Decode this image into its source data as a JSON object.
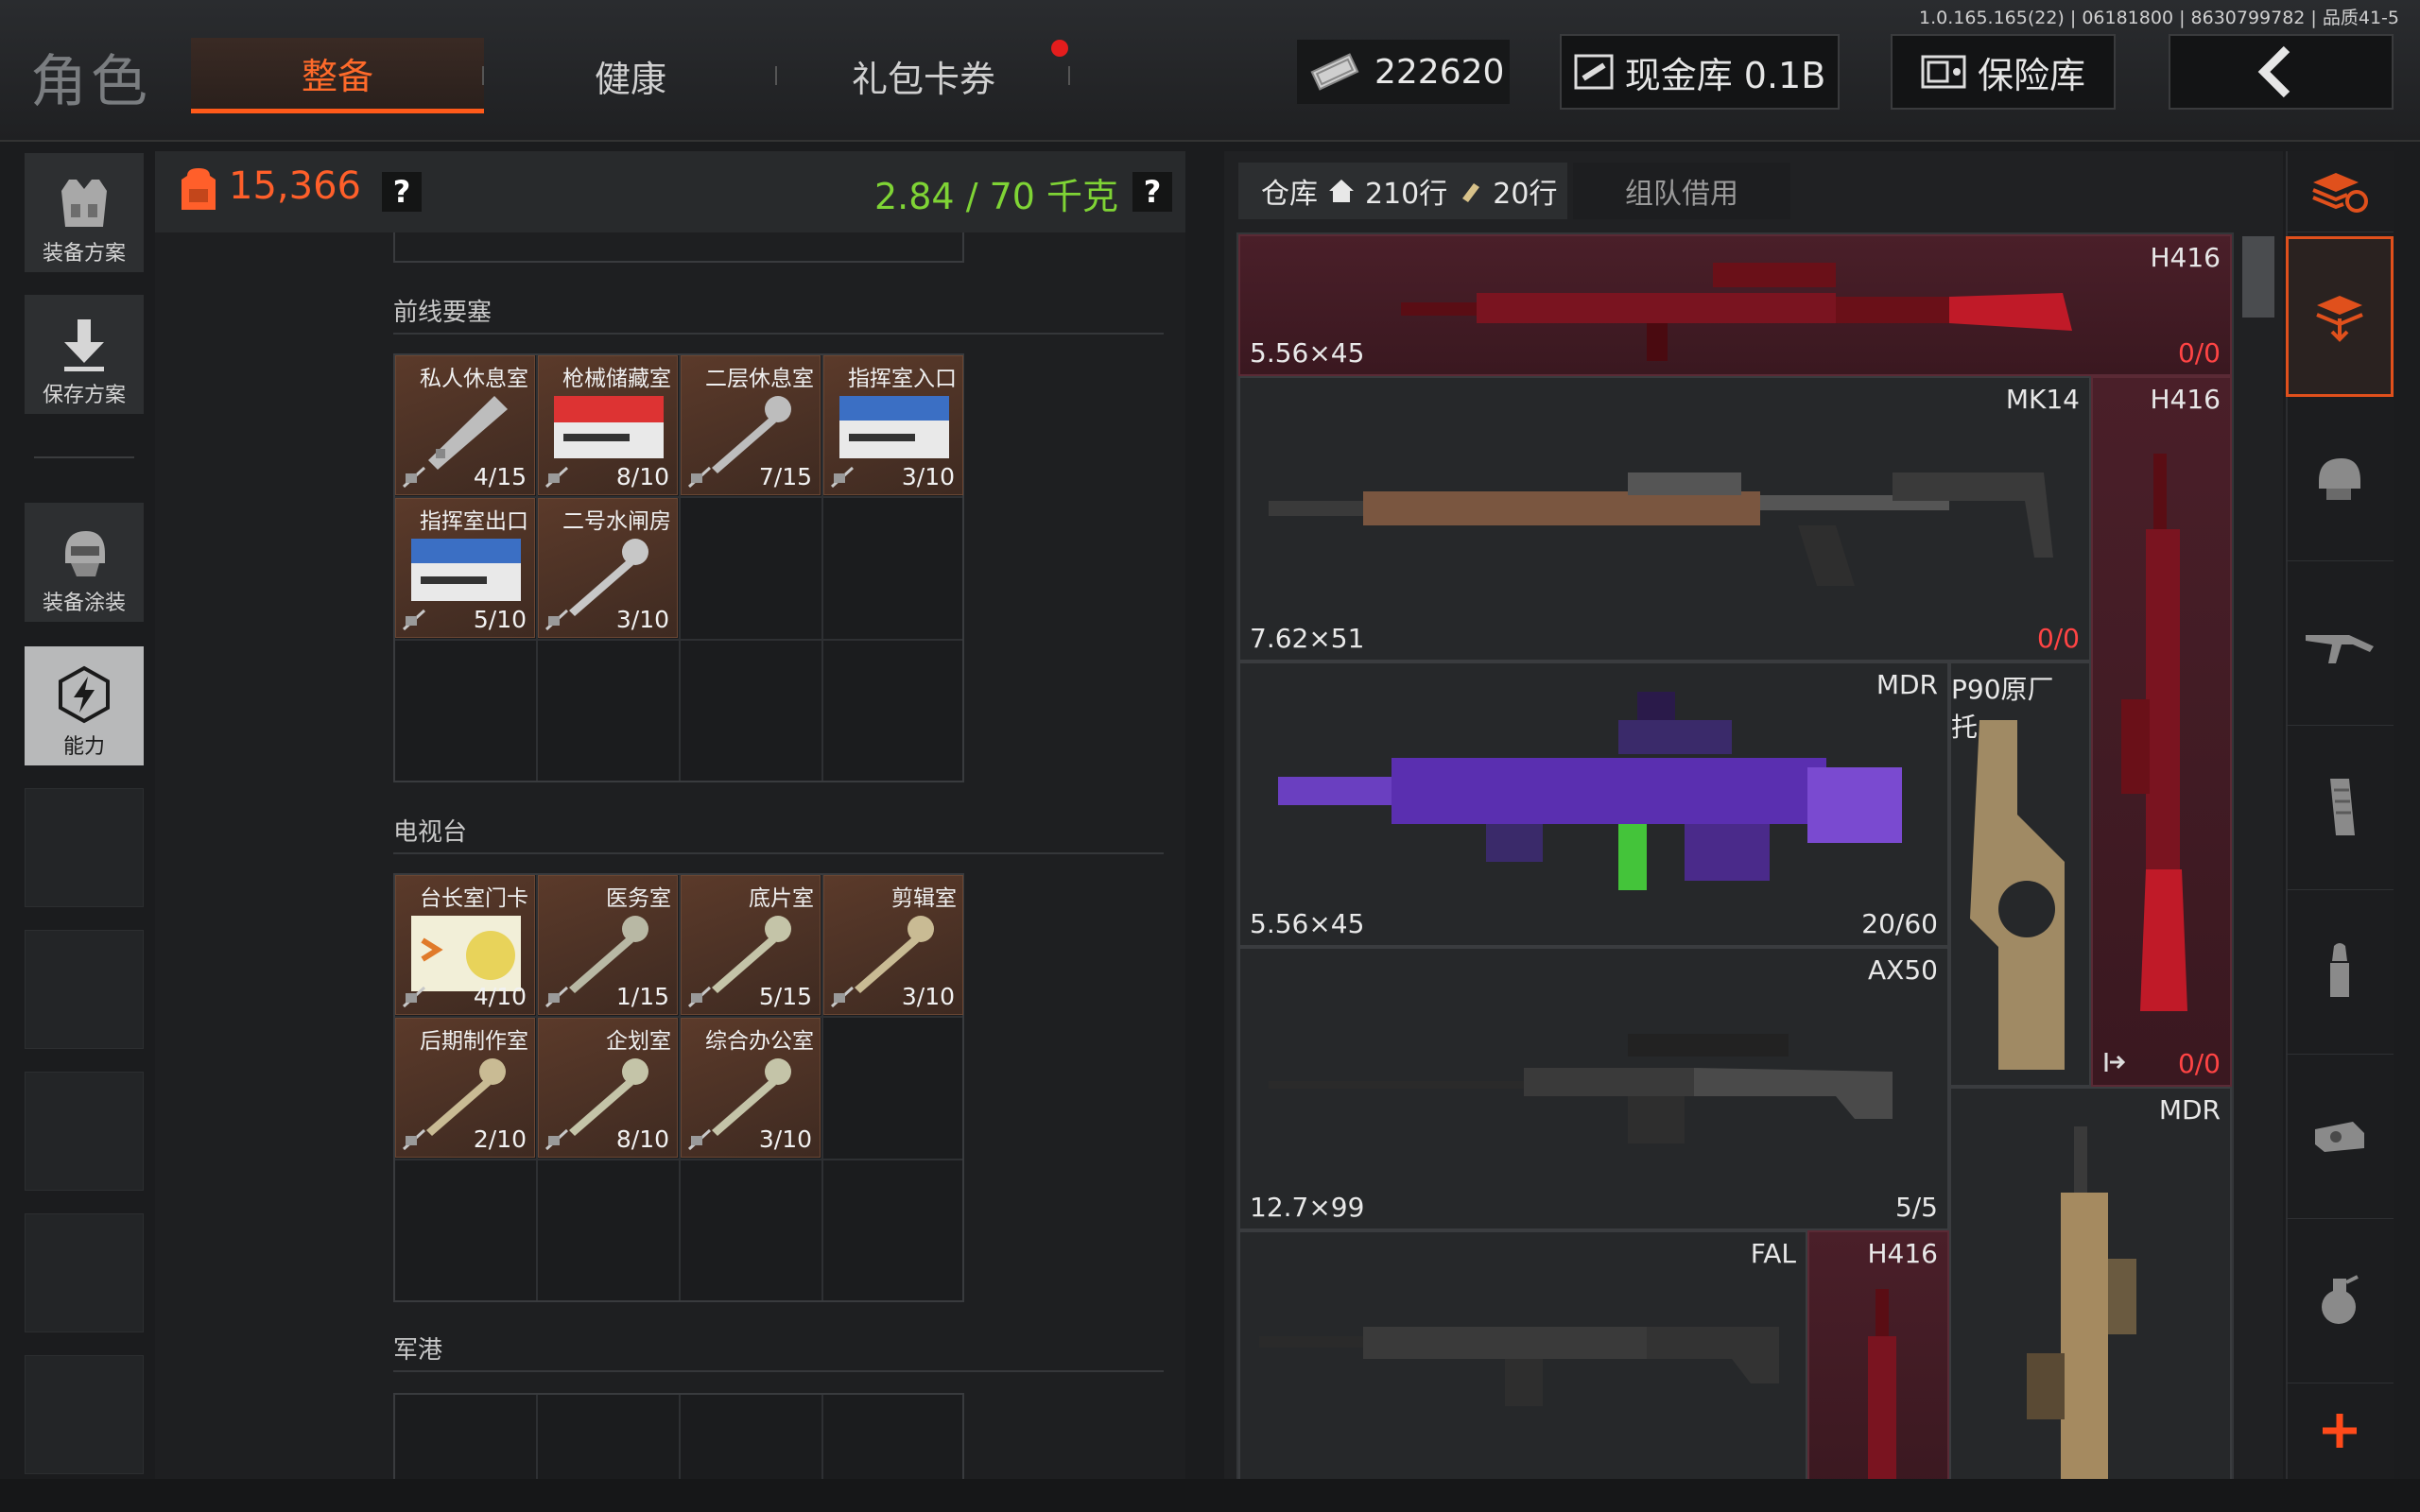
{
  "version": "1.0.165.165(22) | 06181800 | 8630799782 | 品质41-5",
  "title": "角色",
  "tabs": {
    "gear": "整备",
    "health": "健康",
    "coupons": "礼包卡券"
  },
  "currency": {
    "amount": "222620"
  },
  "buttons": {
    "cash_vault": "现金库 0.1B",
    "safe_box": "保险库"
  },
  "sidebar": {
    "loadout_plan": "装备方案",
    "save_plan": "保存方案",
    "gear_skin": "装备涂装",
    "ability": "能力"
  },
  "left_panel": {
    "backpack_value": "15,366",
    "weight": "2.84 / 70 千克",
    "help": "?"
  },
  "sections": [
    {
      "title": "前线要塞",
      "keys": [
        {
          "name": "私人休息室",
          "uses": "4/15"
        },
        {
          "name": "枪械储藏室",
          "uses": "8/10"
        },
        {
          "name": "二层休息室",
          "uses": "7/15"
        },
        {
          "name": "指挥室入口",
          "uses": "3/10"
        },
        {
          "name": "指挥室出口",
          "uses": "5/10"
        },
        {
          "name": "二号水闸房",
          "uses": "3/10"
        }
      ]
    },
    {
      "title": "电视台",
      "keys": [
        {
          "name": "台长室门卡",
          "uses": "4/10"
        },
        {
          "name": "医务室",
          "uses": "1/15"
        },
        {
          "name": "底片室",
          "uses": "5/15"
        },
        {
          "name": "剪辑室",
          "uses": "3/10"
        },
        {
          "name": "后期制作室",
          "uses": "2/10"
        },
        {
          "name": "企划室",
          "uses": "8/10"
        },
        {
          "name": "综合办公室",
          "uses": "3/10"
        }
      ]
    },
    {
      "title": "军港",
      "keys": []
    }
  ],
  "storage": {
    "tab_label": "仓库",
    "rows_home": "210行",
    "rows_ammo": "20行",
    "team_borrow": "组队借用"
  },
  "weapons": [
    {
      "name": "H416",
      "caliber": "5.56×45",
      "ammo": "0/0"
    },
    {
      "name": "MK14",
      "caliber": "7.62×51",
      "ammo": "0/0"
    },
    {
      "name": "H416",
      "caliber": "",
      "ammo": "0/0"
    },
    {
      "name": "MDR",
      "caliber": "5.56×45",
      "ammo": "20/60"
    },
    {
      "name": "P90原厂托",
      "caliber": "",
      "ammo": ""
    },
    {
      "name": "AX50",
      "caliber": "12.7×99",
      "ammo": "5/5"
    },
    {
      "name": "MDR",
      "caliber": "",
      "ammo": ""
    },
    {
      "name": "FAL",
      "caliber": "",
      "ammo": ""
    },
    {
      "name": "H416",
      "caliber": "",
      "ammo": ""
    }
  ],
  "colors": {
    "accent": "#ff5a1a",
    "weight_green": "#7fd435",
    "ammo_empty": "#ff4444",
    "rare_slot": "#4a1f29"
  }
}
